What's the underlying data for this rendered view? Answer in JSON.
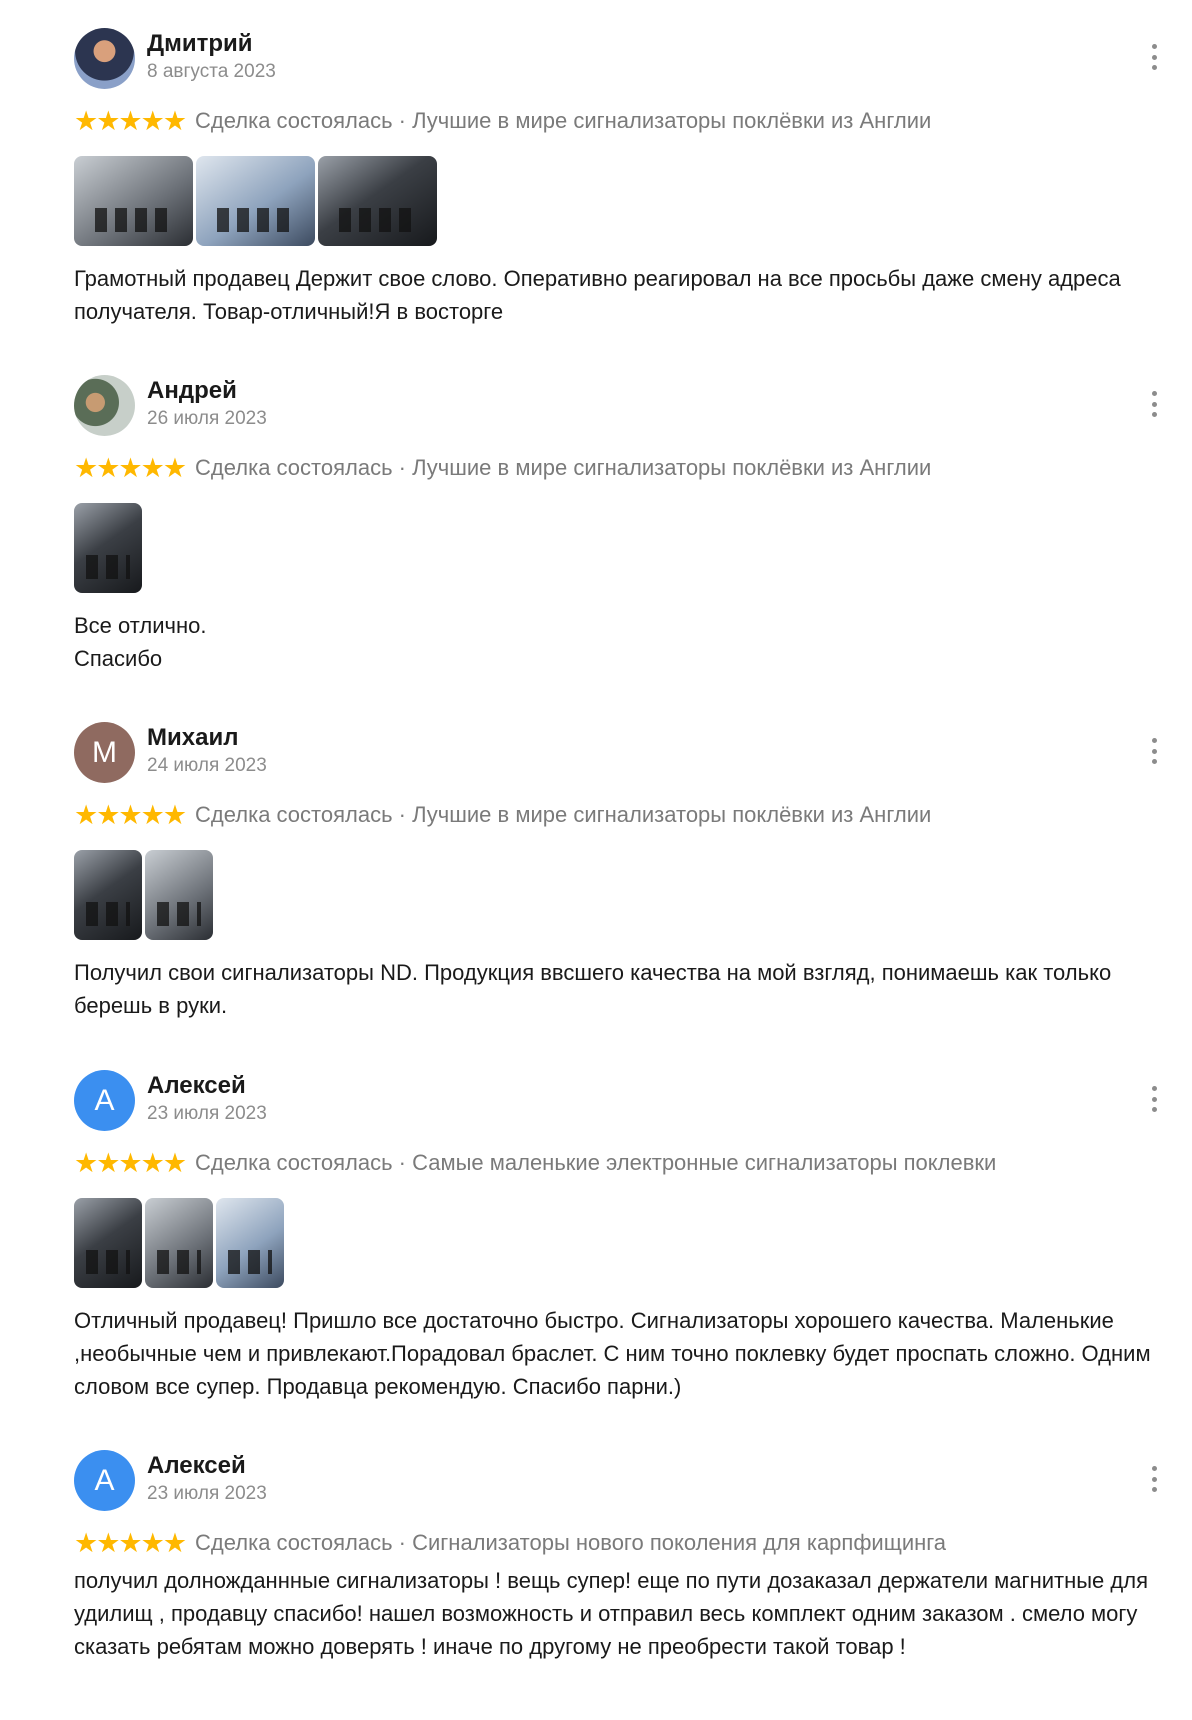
{
  "colors": {
    "star": "#ffb800",
    "meta": "#8c8c8c",
    "avatar_m": "#8f6a60",
    "avatar_a": "#3b8ff0"
  },
  "reviews": [
    {
      "author": "Дмитрий",
      "date": "8 августа 2023",
      "avatar": "photo",
      "rating": 5,
      "stars": "★★★★★",
      "tag": "Сделка состоялась · Лучшие в мире сигнализаторы поклёвки из Англии",
      "photo_count": 3,
      "text": "Грамотный продавец Держит свое слово. Оперативно реагировал на все просьбы даже смену адреса получателя. Товар-отличный!Я в восторге"
    },
    {
      "author": "Андрей",
      "date": "26 июля 2023",
      "avatar": "photo",
      "rating": 5,
      "stars": "★★★★★",
      "tag": "Сделка состоялась · Лучшие в мире сигнализаторы поклёвки из Англии",
      "photo_count": 1,
      "text": "Все отлично.\nСпасибо"
    },
    {
      "author": "Михаил",
      "date": "24 июля 2023",
      "avatar_letter": "М",
      "rating": 5,
      "stars": "★★★★★",
      "tag": "Сделка состоялась · Лучшие в мире сигнализаторы поклёвки из Англии",
      "photo_count": 2,
      "text": "Получил свои сигнализаторы ND. Продукция ввсшего качества на мой взгляд, понимаешь как только берешь в руки."
    },
    {
      "author": "Алексей",
      "date": "23 июля 2023",
      "avatar_letter": "А",
      "rating": 5,
      "stars": "★★★★★",
      "tag": "Сделка состоялась · Самые маленькие электронные сигнализаторы поклевки",
      "photo_count": 3,
      "text": "Отличный продавец! Пришло все достаточно быстро. Сигнализаторы хорошего качества. Маленькие ,необычные чем и привлекают.Порадовал браслет. С ним точно поклевку будет проспать сложно. Одним словом все супер. Продавца рекомендую. Спасибо парни.)"
    },
    {
      "author": "Алексей",
      "date": "23 июля 2023",
      "avatar_letter": "А",
      "rating": 5,
      "stars": "★★★★★",
      "tag": "Сделка состоялась · Сигнализаторы нового поколения для карпфищинга",
      "photo_count": 0,
      "text": "получил долножданнные сигнализаторы ! вещь супер! еще по пути дозаказал держатели магнитные для удилищ , продавцу спасибо! нашел возможность и отправил весь комплект одним заказом . смело могу сказать ребятам можно доверять ! иначе по другому не преобрести такой товар !"
    }
  ]
}
